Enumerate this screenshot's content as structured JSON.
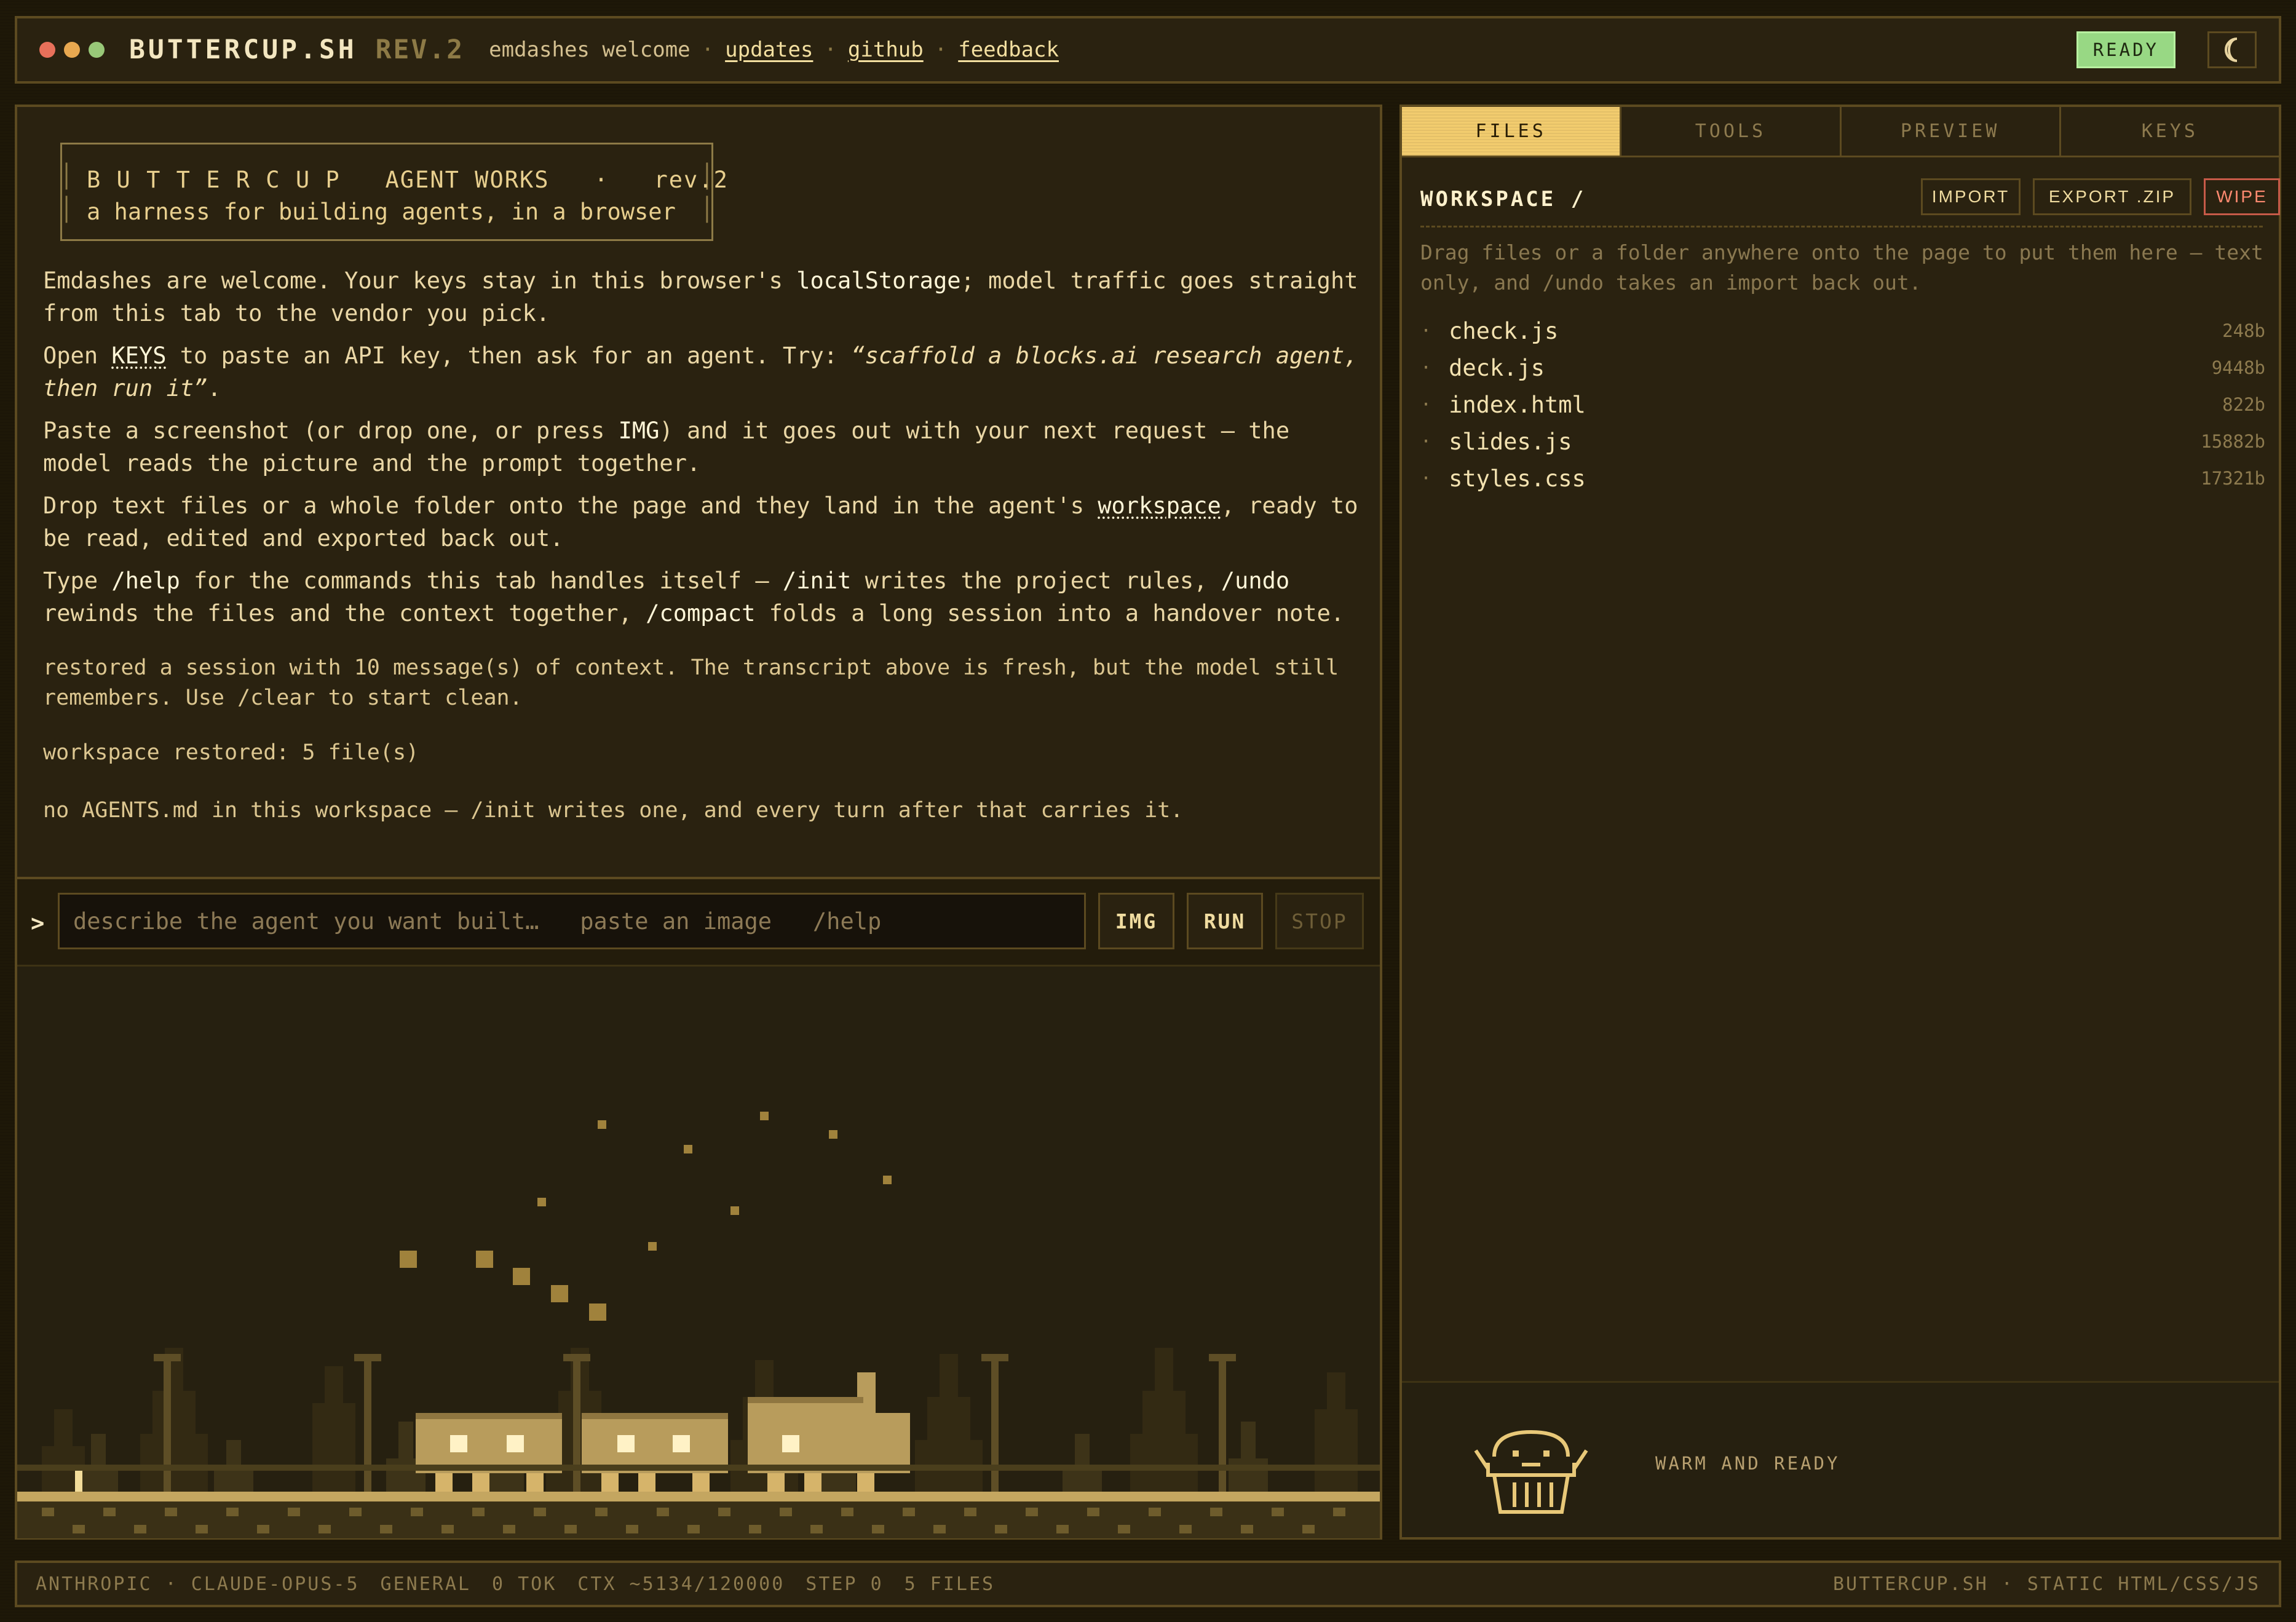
{
  "header": {
    "brand": "BUTTERCUP.SH",
    "rev": "REV.2",
    "tagline": "emdashes welcome",
    "links": [
      "updates",
      "github",
      "feedback"
    ],
    "separator": "·",
    "status": "READY",
    "theme_icon": "moon-icon",
    "dot_colors": [
      "#e8705a",
      "#e8a850",
      "#98c878"
    ]
  },
  "intro": {
    "box_line1": "B U T T E R C U P   AGENT WORKS   ·   rev.2",
    "box_line2": "a harness for building agents, in a browser",
    "p1_a": "Emdashes are welcome. Your keys stay in this browser's ",
    "p1_code": "localStorage",
    "p1_b": "; model traffic goes straight from this tab to the vendor you pick.",
    "p2_a": "Open ",
    "p2_keys": "KEYS",
    "p2_b": " to paste an API key, then ask for an agent. Try: ",
    "p2_quote": "“scaffold a blocks.ai research agent, then run it”",
    "p2_c": ".",
    "p3_a": "Paste a screenshot (or drop one, or press ",
    "p3_img": "IMG",
    "p3_b": ") and it goes out with your next request — the model reads the picture and the prompt together.",
    "p4_a": "Drop text files or a whole folder onto the page and they land in the agent's ",
    "p4_ws": "workspace",
    "p4_b": ", ready to be read, edited and exported back out.",
    "p5_a": "Type ",
    "p5_help": "/help",
    "p5_b": " for the commands this tab handles itself — ",
    "p5_init": "/init",
    "p5_c": " writes the project rules, ",
    "p5_undo": "/undo",
    "p5_d": " rewinds the files and the context together, ",
    "p5_compact": "/compact",
    "p5_e": " folds a long session into a handover note."
  },
  "log": [
    "restored a session with 10 message(s) of context. The transcript above is fresh, but the model still remembers. Use /clear to start clean.",
    "workspace restored: 5 file(s)",
    "no AGENTS.md in this workspace — /init writes one, and every turn after that carries it."
  ],
  "prompt": {
    "caret": ">",
    "placeholder": "describe the agent you want built…   paste an image   /help",
    "buttons": {
      "img": "IMG",
      "run": "RUN",
      "stop": "STOP"
    }
  },
  "sidebar": {
    "tabs": [
      "FILES",
      "TOOLS",
      "PREVIEW",
      "KEYS"
    ],
    "active_tab": "FILES",
    "workspace_title": "WORKSPACE /",
    "actions": {
      "import": "IMPORT",
      "export": "EXPORT .ZIP",
      "wipe": "WIPE"
    },
    "hint": "Drag files or a folder anywhere onto the page to put them here — text only, and /undo takes an import back out.",
    "bullet": "·",
    "files": [
      {
        "name": "check.js",
        "size": "248b"
      },
      {
        "name": "deck.js",
        "size": "9448b"
      },
      {
        "name": "index.html",
        "size": "822b"
      },
      {
        "name": "slides.js",
        "size": "15882b"
      },
      {
        "name": "styles.css",
        "size": "17321b"
      }
    ],
    "mascot_status": "WARM AND READY"
  },
  "footer": {
    "items": [
      "ANTHROPIC · CLAUDE-OPUS-5",
      "GENERAL",
      "0 TOK",
      "CTX ~5134/120000",
      "STEP 0",
      "5 FILES"
    ],
    "right": "BUTTERCUP.SH · STATIC HTML/CSS/JS"
  },
  "colors": {
    "accent": "#f2cc6e",
    "ready": "#98d884",
    "wipe": "#ff8a70",
    "background": "#1e1808",
    "panel": "#2a2210"
  }
}
